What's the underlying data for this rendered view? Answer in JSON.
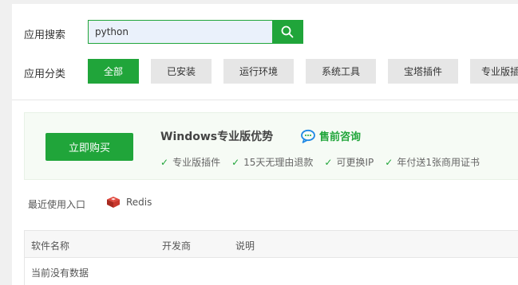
{
  "search": {
    "label": "应用搜索",
    "value": "python",
    "button_icon": "search-icon"
  },
  "category": {
    "label": "应用分类",
    "items": [
      {
        "label": "全部",
        "active": true
      },
      {
        "label": "已安装",
        "active": false
      },
      {
        "label": "运行环境",
        "active": false
      },
      {
        "label": "系统工具",
        "active": false
      },
      {
        "label": "宝塔插件",
        "active": false
      },
      {
        "label": "专业版插件",
        "active": false
      }
    ]
  },
  "promo": {
    "buy_label": "立即购买",
    "title": "Windows专业版优势",
    "consult_label": "售前咨询",
    "features": [
      "专业版插件",
      "15天无理由退款",
      "可更换IP",
      "年付送1张商用证书"
    ]
  },
  "recent": {
    "label": "最近使用入口",
    "items": [
      {
        "label": "Redis",
        "icon": "redis-icon"
      }
    ]
  },
  "table": {
    "headers": [
      "软件名称",
      "开发商",
      "说明"
    ],
    "empty_text": "当前没有数据"
  },
  "colors": {
    "accent": "#20a53a",
    "page_bg": "#f0f0f0",
    "category_bg": "#e6e6e6",
    "promo_bg": "#f6fbf5"
  }
}
